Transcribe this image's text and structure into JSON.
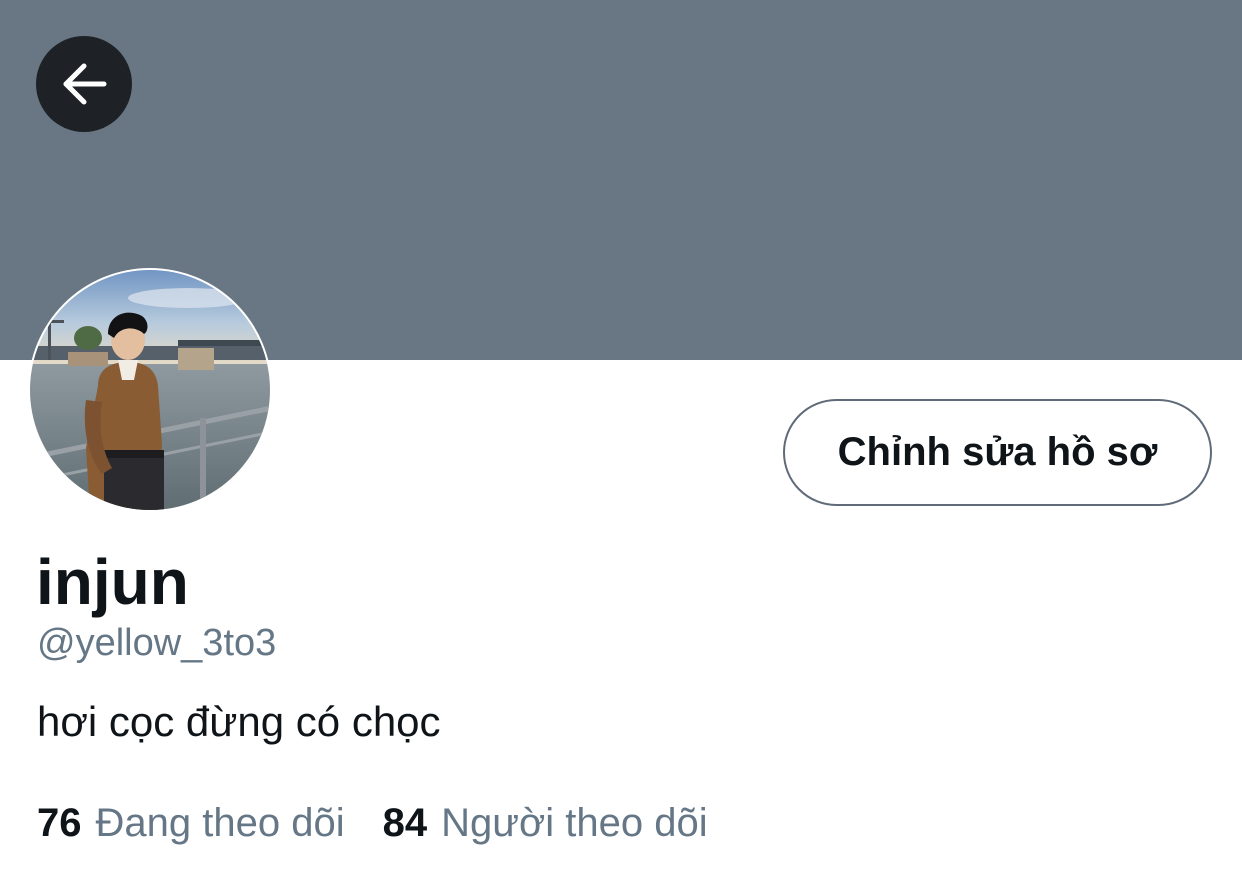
{
  "colors": {
    "banner": "#697784",
    "back_button_bg": "#1e2226",
    "primary_text": "#0f1419",
    "secondary_text": "#657786",
    "button_border": "#5f6b78"
  },
  "header": {
    "back_icon": "arrow-left-icon"
  },
  "profile": {
    "edit_button_label": "Chỉnh sửa hồ sơ",
    "display_name": "injun",
    "handle": "@yellow_3to3",
    "bio": "hơi cọc đừng có chọc"
  },
  "stats": {
    "following_count": "76",
    "following_label": "Đang theo dõi",
    "followers_count": "84",
    "followers_label": "Người theo dõi"
  }
}
